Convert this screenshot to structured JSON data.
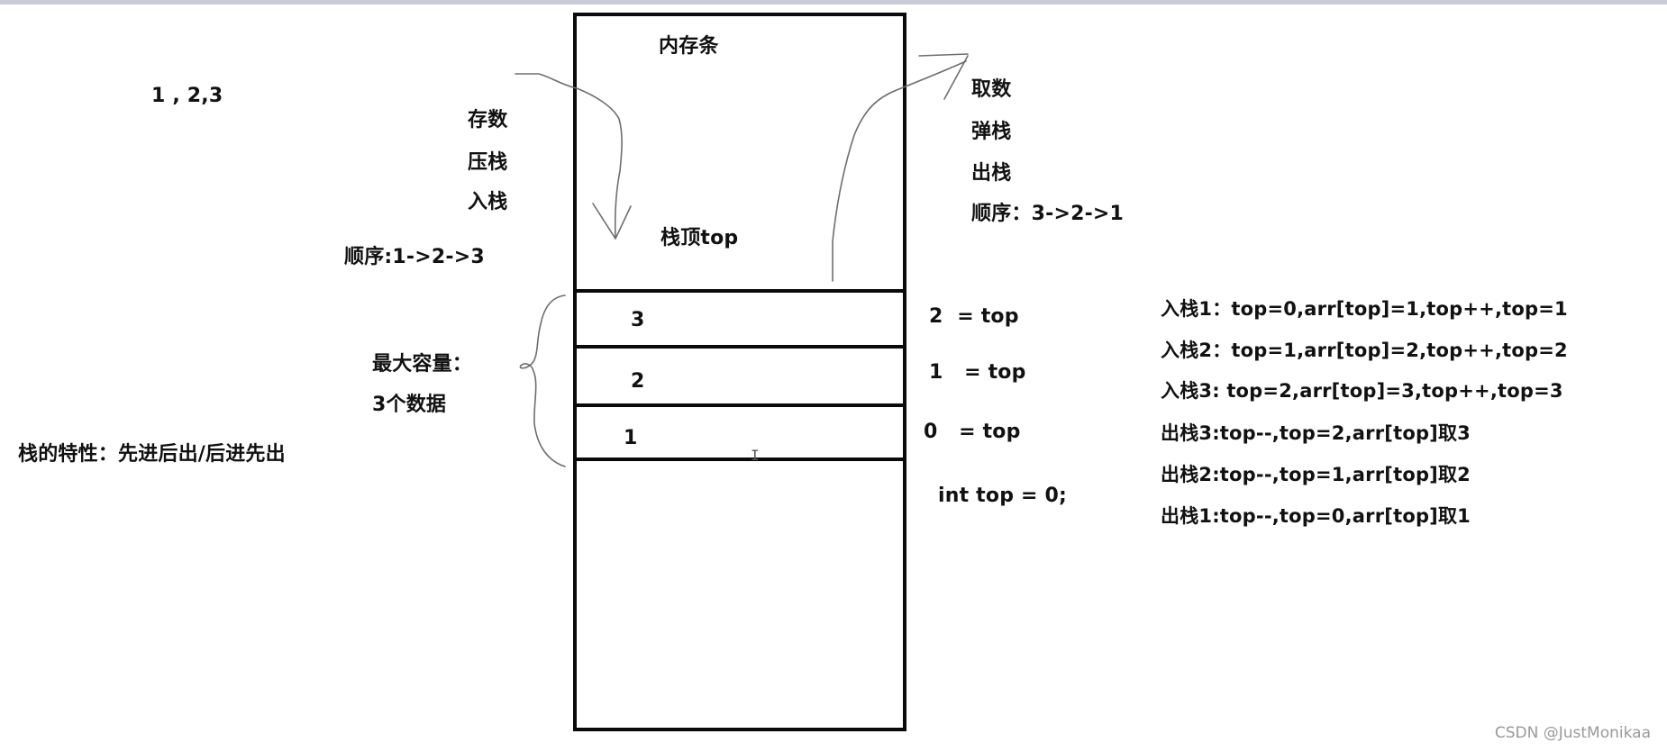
{
  "diagram": {
    "input_values": "1 , 2,3",
    "push_labels": [
      "存数",
      "压栈",
      "入栈"
    ],
    "push_order": "顺序:1->2->3",
    "pop_labels": [
      "取数",
      "弹栈",
      "出栈"
    ],
    "pop_order": "顺序：3->2->1",
    "memory_label": "内存条",
    "stack_top_label": "栈顶top",
    "cells": [
      {
        "value": "3",
        "index_label": "2  = top"
      },
      {
        "value": "2",
        "index_label": "1   = top"
      },
      {
        "value": "1",
        "index_label": "0   = top"
      }
    ],
    "capacity_label": [
      "最大容量：",
      "3个数据"
    ],
    "property_label": "栈的特性：先进后出/后进先出",
    "init_code": "int top = 0;",
    "steps": [
      "入栈1：top=0,arr[top]=1,top++,top=1",
      "入栈2：top=1,arr[top]=2,top++,top=2",
      "入栈3: top=2,arr[top]=3,top++,top=3",
      "出栈3:top--,top=2,arr[top]取3",
      "出栈2:top--,top=1,arr[top]取2",
      "出栈1:top--,top=0,arr[top]取1"
    ],
    "icons": {
      "push_arrow": "arrow-down-curved",
      "pop_arrow": "arrow-up-curved",
      "brace": "curly-brace",
      "cursor": "text-cursor"
    }
  },
  "watermark": "CSDN @JustMonikaa",
  "colors": {
    "ink": "#111111",
    "pencil": "#6e6e6e",
    "topbar": "#c9ccd8",
    "watermark": "#9a9a9a"
  }
}
